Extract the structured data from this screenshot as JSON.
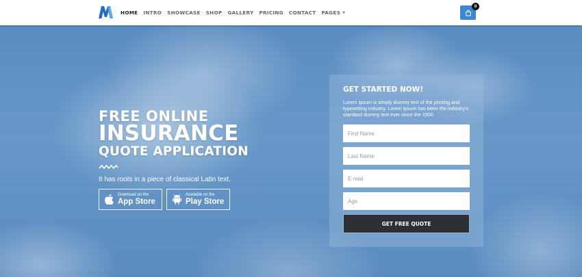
{
  "colors": {
    "accent": "#3a87d4",
    "button_dark": "#2c2f33",
    "sky": "#5b8dc1",
    "text_light": "#ffffff"
  },
  "header": {
    "logo_icon": "m-logo-icon",
    "nav": [
      {
        "label": "HOME",
        "active": true
      },
      {
        "label": "INTRO"
      },
      {
        "label": "SHOWCASE"
      },
      {
        "label": "SHOP"
      },
      {
        "label": "GALLERY"
      },
      {
        "label": "PRICING"
      },
      {
        "label": "CONTACT"
      },
      {
        "label": "PAGES",
        "dropdown": true
      }
    ],
    "cart_icon": "shopping-bag-icon",
    "cart_count": "0"
  },
  "hero": {
    "headline_line1": "FREE ONLINE",
    "headline_line2": "INSURANCE",
    "headline_line3": "QUOTE APPLICATION",
    "tagline": "It has roots in a piece of classical Latin text.",
    "app_store": {
      "small": "Download on the",
      "big": "App Store",
      "icon": "apple-icon"
    },
    "play_store": {
      "small": "Available on the",
      "big": "Play Store",
      "icon": "android-icon"
    }
  },
  "form": {
    "title": "GET STARTED NOW!",
    "description": "Lorem Ipsum is simply dummy text of the printing and typesetting industry. Lorem Ipsum has been the industry's standard dummy text ever since the 1500",
    "first_name_placeholder": "First Name",
    "last_name_placeholder": "Last Name",
    "email_placeholder": "E-mail",
    "age_placeholder": "Age",
    "submit_label": "GET FREE QUOTE"
  }
}
